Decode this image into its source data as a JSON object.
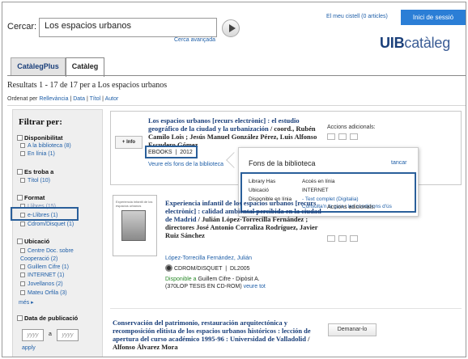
{
  "header": {
    "search_label": "Cercar:",
    "search_value": "Los espacios urbanos",
    "advanced_link": "Cerca avançada",
    "cart_link": "El meu cistell (0 articles)",
    "login_button": "Inici de sessió",
    "logo_bold": "UIB",
    "logo_light": "catàleg"
  },
  "tabs": [
    {
      "label": "CatàlegPlus"
    },
    {
      "label": "Catàleg"
    }
  ],
  "results": {
    "summary": "Resultats 1 - 17 de 17 per a Los espacios urbanos",
    "sort_prefix": "Ordenat per",
    "sort_options": [
      "Rellevància",
      "Data",
      "Títol",
      "Autor"
    ]
  },
  "sidebar": {
    "title": "Filtrar per:",
    "groups": [
      {
        "heading": "Disponibilitat",
        "items": [
          "A la biblioteca (8)",
          "En línia (1)"
        ]
      },
      {
        "heading": "Es troba a",
        "items": [
          "Títol (10)"
        ]
      },
      {
        "heading": "Format",
        "items": [
          "Llibres (15)",
          "e-Llibres (1)",
          "Cdrom/Disquet (1)"
        ]
      },
      {
        "heading": "Ubicació",
        "items": [
          "Centre Doc. sobre Cooperació (2)",
          "Guillem Cifre (1)",
          "INTERNET (1)",
          "Jovellanos (2)",
          "Mateu Orfila (3)"
        ]
      },
      {
        "heading": "Data de publicació",
        "items": []
      }
    ],
    "more_link": "més",
    "date_placeholder": "yyyy",
    "date_separator": "a",
    "apply_link": "apply"
  },
  "record1": {
    "title": "Los espacios urbanos [recurs electrònic] : el estudio geográfico de la ciudad y la urbanización",
    "authors": "/ coord., Rubén Camilo Lois ; Jesús Manuel González Pérez, Luis Alfonso Escudero Gómez",
    "format": "EBOOKS",
    "year": "2012",
    "view_link": "Veure els fons de la biblioteca",
    "info_button": "+ Info",
    "actions_label": "Accions adicionals:"
  },
  "popup": {
    "title": "Fons de la biblioteca",
    "close": "tancar",
    "rows": [
      {
        "key": "Library Has",
        "value": "Accés en línia"
      },
      {
        "key": "Ubicació",
        "value": "INTERNET"
      },
      {
        "key": "Disponible en línia",
        "value": "- Text complet (Digitalia)"
      }
    ],
    "conditions_link": "Consulta'n la guia i les condicions d'ús"
  },
  "record2": {
    "title": "Experiencia infantil de los espacios urbanos [recurs electrònic] : calidad ambiental percibida en la ciudad de Madrid",
    "authors": "/ Julián López-Torrecilla Fernández ; directores José Antonio Corraliza Rodríguez, Javier Ruiz Sánchez",
    "author_link": "López-Torrecilla Fernández, Julián",
    "format": "CDROM/DISQUET",
    "year": "DL2005",
    "availability_label": "Disponible a",
    "availability_value": "Guillem Cifre - Dipòsit A.",
    "callnumber": "(370LOP TESIS EN CD-ROM)",
    "more_link": "veure tot",
    "actions_label": "Accions adicionals:",
    "cover_text": "Experiencia infantil de los espacios urbanos"
  },
  "record3": {
    "title": "Conservación del patrimonio, restauración arquitectónica y recomposición elitista de los espacios urbanos históricos : lección de apertura del curso académico 1995-96 : Universidad de Valladolid",
    "authors": "/ Alfonso Álvarez Mora",
    "request_button": "Demanar-lo"
  },
  "colors": {
    "accent": "#2b7ed6",
    "title_navy": "#1a3f7a",
    "link_blue": "#1f5fa8",
    "highlight_border": "#2a5f9a"
  }
}
